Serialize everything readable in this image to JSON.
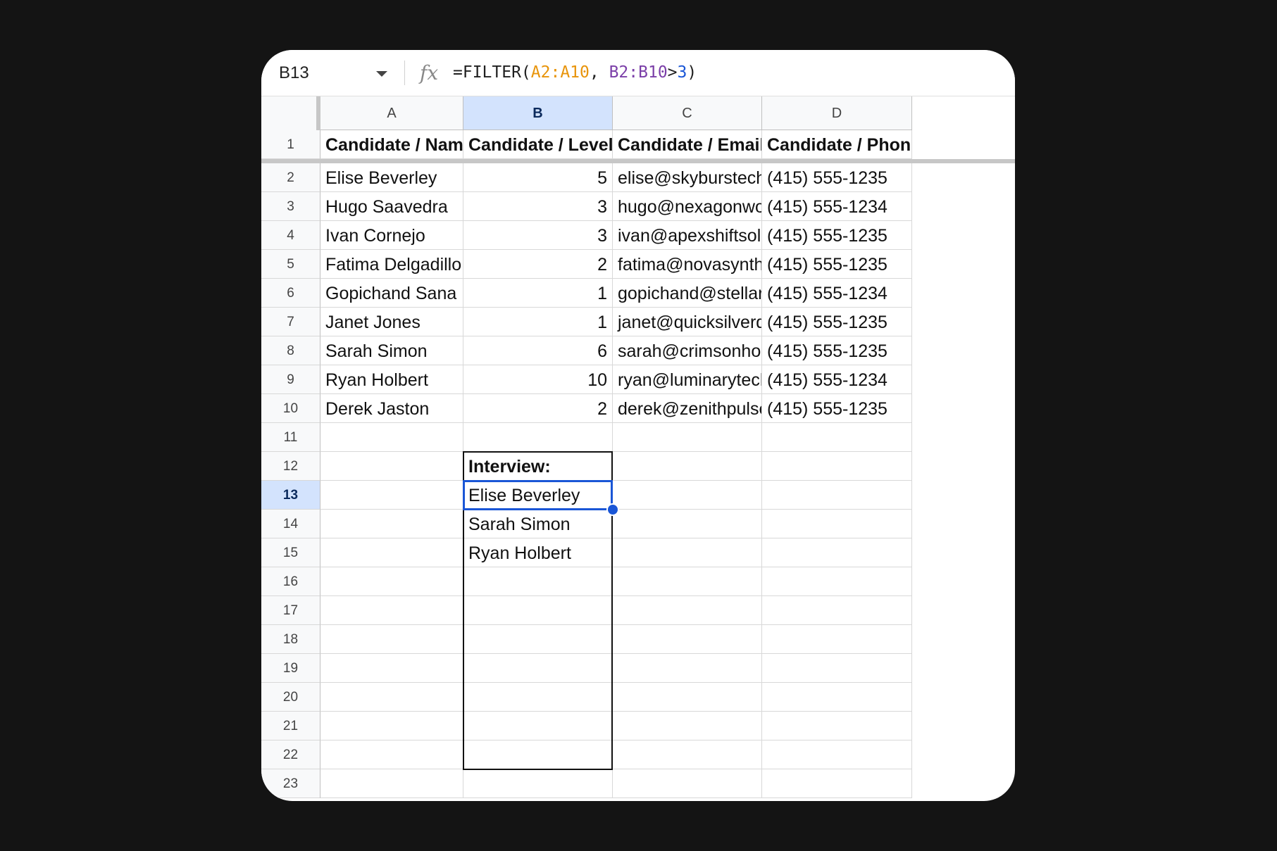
{
  "formula_bar": {
    "cell_ref": "B13",
    "fx_label": "fx",
    "formula_parts": [
      {
        "text": "=FILTER(",
        "color": "#1f1f1f"
      },
      {
        "text": "A2:A10",
        "color": "#e8940a"
      },
      {
        "text": ", ",
        "color": "#1f1f1f"
      },
      {
        "text": "B2:B10",
        "color": "#7b3fa8"
      },
      {
        "text": ">",
        "color": "#1f1f1f"
      },
      {
        "text": "3",
        "color": "#1a56d6"
      },
      {
        "text": ")",
        "color": "#1f1f1f"
      }
    ]
  },
  "columns": [
    "A",
    "B",
    "C",
    "D"
  ],
  "selected_column": "B",
  "selected_row": "13",
  "rows": [
    {
      "num": "1",
      "cells": [
        "Candidate / Name (F",
        "Candidate / Level",
        "Candidate / Email",
        "Candidate / Phone"
      ]
    },
    {
      "num": "2",
      "cells": [
        "Elise Beverley",
        "5",
        "elise@skyburstech.c",
        "(415) 555-1235"
      ]
    },
    {
      "num": "3",
      "cells": [
        "Hugo Saavedra",
        "3",
        "hugo@nexagonwork",
        "(415) 555-1234"
      ]
    },
    {
      "num": "4",
      "cells": [
        "Ivan Cornejo",
        "3",
        "ivan@apexshiftsoluti",
        "(415) 555-1235"
      ]
    },
    {
      "num": "5",
      "cells": [
        "Fatima Delgadillo",
        "2",
        "fatima@novasynthgr",
        "(415) 555-1235"
      ]
    },
    {
      "num": "6",
      "cells": [
        "Gopichand Sana",
        "1",
        "gopichand@stellarby",
        "(415) 555-1234"
      ]
    },
    {
      "num": "7",
      "cells": [
        "Janet Jones",
        "1",
        "janet@quicksilverdev",
        "(415) 555-1235"
      ]
    },
    {
      "num": "8",
      "cells": [
        "Sarah Simon",
        "6",
        "sarah@crimsonhoriz",
        "(415) 555-1235"
      ]
    },
    {
      "num": "9",
      "cells": [
        "Ryan Holbert",
        "10",
        "ryan@luminarytechs",
        "(415) 555-1234"
      ]
    },
    {
      "num": "10",
      "cells": [
        "Derek Jaston",
        "2",
        "derek@zenithpulse.n",
        "(415) 555-1235"
      ]
    },
    {
      "num": "11",
      "cells": [
        "",
        "",
        "",
        ""
      ]
    },
    {
      "num": "12",
      "cells": [
        "",
        "Interview:",
        "",
        ""
      ]
    },
    {
      "num": "13",
      "cells": [
        "",
        "Elise Beverley",
        "",
        ""
      ]
    },
    {
      "num": "14",
      "cells": [
        "",
        "Sarah Simon",
        "",
        ""
      ]
    },
    {
      "num": "15",
      "cells": [
        "",
        "Ryan Holbert",
        "",
        ""
      ]
    },
    {
      "num": "16",
      "cells": [
        "",
        "",
        "",
        ""
      ]
    },
    {
      "num": "17",
      "cells": [
        "",
        "",
        "",
        ""
      ]
    },
    {
      "num": "18",
      "cells": [
        "",
        "",
        "",
        ""
      ]
    },
    {
      "num": "19",
      "cells": [
        "",
        "",
        "",
        ""
      ]
    },
    {
      "num": "20",
      "cells": [
        "",
        "",
        "",
        ""
      ]
    },
    {
      "num": "21",
      "cells": [
        "",
        "",
        "",
        ""
      ]
    },
    {
      "num": "22",
      "cells": [
        "",
        "",
        "",
        ""
      ]
    },
    {
      "num": "23",
      "cells": [
        "",
        "",
        "",
        ""
      ]
    }
  ]
}
